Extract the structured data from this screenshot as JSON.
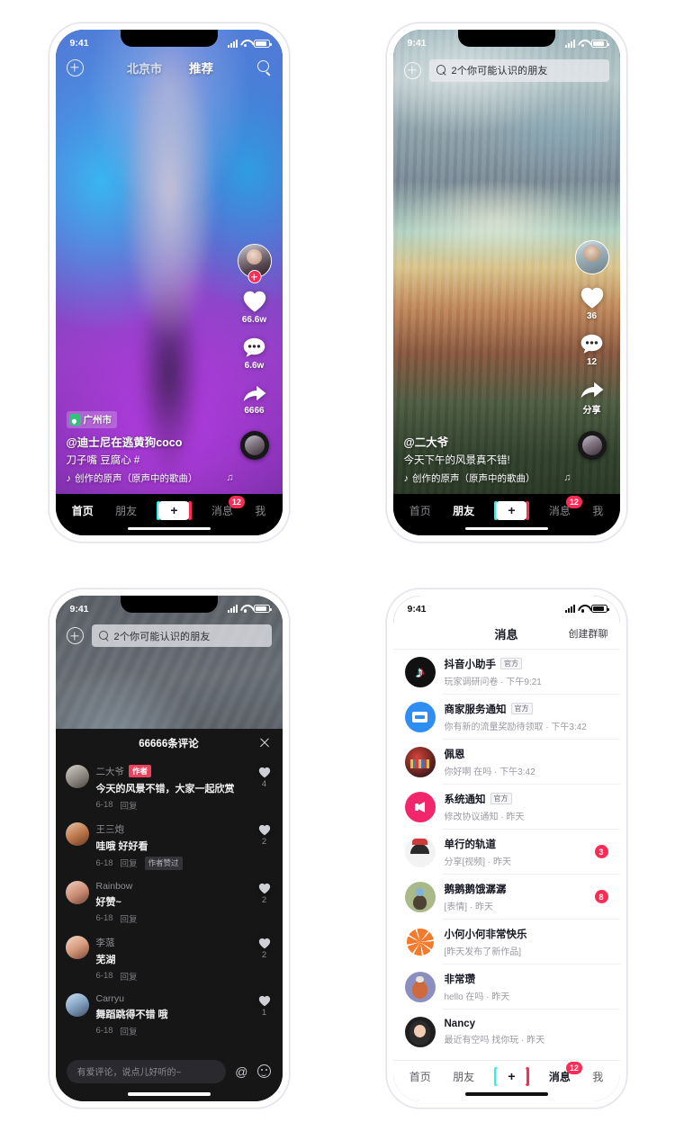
{
  "status_bar": {
    "time": "9:41",
    "signal_icon": "cellular-bars-icon",
    "wifi_icon": "wifi-icon",
    "battery_icon": "battery-icon"
  },
  "screen1": {
    "name": "home-feed",
    "nav": {
      "add_friend_icon": "plus-circle-icon",
      "tabs": [
        {
          "label": "北京市",
          "active": false
        },
        {
          "label": "推荐",
          "active": true
        }
      ],
      "search_icon": "search-icon"
    },
    "rail": {
      "avatar_name": "creator-avatar",
      "follow_icon": "follow-plus-icon",
      "like_icon": "heart-icon",
      "like_count": "66.6w",
      "comment_icon": "comment-icon",
      "comment_count": "6.6w",
      "share_icon": "share-arrow-icon",
      "share_count": "6666",
      "music_disc": "music-disc-icon"
    },
    "caption": {
      "location_icon": "location-pin-icon",
      "location": "广州市",
      "username": "@迪士尼在逃黄狗coco",
      "text": "刀子嘴 豆腐心 #",
      "music_icon": "music-note-icon",
      "music": "创作的原声（原声中的歌曲）"
    }
  },
  "screen2": {
    "name": "friends-feed",
    "header": {
      "add_friend_icon": "plus-circle-icon",
      "search_icon": "search-icon",
      "search_placeholder": "2个你可能认识的朋友"
    },
    "rail": {
      "avatar_name": "creator-avatar",
      "like_icon": "heart-icon",
      "like_count": "36",
      "comment_icon": "comment-icon",
      "comment_count": "12",
      "share_icon": "share-arrow-icon",
      "share_label": "分享",
      "music_disc": "music-disc-icon"
    },
    "caption": {
      "username": "@二大爷",
      "text": "今天下午的风景真不错!",
      "music_icon": "music-note-icon",
      "music": "创作的原声（原声中的歌曲）"
    }
  },
  "screen3": {
    "name": "comments-sheet",
    "header": {
      "add_friend_icon": "plus-circle-icon",
      "search_icon": "search-icon",
      "search_placeholder": "2个你可能认识的朋友"
    },
    "sheet": {
      "title": "66666条评论",
      "close_icon": "close-icon",
      "comments": [
        {
          "name": "二大爷",
          "tag": "作者",
          "text": "今天的风景不错，大家一起欣赏",
          "date": "6-18",
          "reply": "回复",
          "liked_by_author": "",
          "likes": "4",
          "avatar": "cav-1"
        },
        {
          "name": "王三炮",
          "tag": "",
          "text": "哇哦 好好看",
          "date": "6-18",
          "reply": "回复",
          "liked_by_author": "作者赞过",
          "likes": "2",
          "avatar": "cav-2"
        },
        {
          "name": "Rainbow",
          "tag": "",
          "text": "好赞~",
          "date": "6-18",
          "reply": "回复",
          "liked_by_author": "",
          "likes": "2",
          "avatar": "cav-3"
        },
        {
          "name": "李蒎",
          "tag": "",
          "text": "芜湖",
          "date": "6-18",
          "reply": "回复",
          "liked_by_author": "",
          "likes": "2",
          "avatar": "cav-4"
        },
        {
          "name": "Carryu",
          "tag": "",
          "text": "舞蹈跳得不错 哦",
          "date": "6-18",
          "reply": "回复",
          "liked_by_author": "",
          "likes": "1",
          "avatar": "cav-5"
        }
      ],
      "input_placeholder": "有爱评论，说点儿好听的~",
      "at_icon": "at-icon",
      "emoji_icon": "emoji-icon"
    }
  },
  "screen4": {
    "name": "messages",
    "header": {
      "title": "消息",
      "action": "创建群聊"
    },
    "rows": [
      {
        "name": "抖音小助手",
        "tag": "官方",
        "sub": "玩家调研问卷 · 下午9:21",
        "badge": "",
        "avatar": "a-dy"
      },
      {
        "name": "商家服务通知",
        "tag": "官方",
        "sub": "你有新的流量奖励待领取 · 下午3:42",
        "badge": "",
        "avatar": "a-shop"
      },
      {
        "name": "佩恩",
        "tag": "",
        "sub": "你好啊 在吗 · 下午3:42",
        "badge": "",
        "avatar": "a-peien"
      },
      {
        "name": "系统通知",
        "tag": "官方",
        "sub": "修改协议通知 · 昨天",
        "badge": "",
        "avatar": "a-sys"
      },
      {
        "name": "单行的轨道",
        "tag": "",
        "sub": "分享[视频] · 昨天",
        "badge": "3",
        "avatar": "a-cat"
      },
      {
        "name": "鹅鹅鹅饿潺潺",
        "tag": "",
        "sub": "[表情] · 昨天",
        "badge": "8",
        "avatar": "a-duck"
      },
      {
        "name": "小何小何非常快乐",
        "tag": "",
        "sub": "[昨天发布了新作品]",
        "badge": "",
        "avatar": "a-orange"
      },
      {
        "name": "非常瓒",
        "tag": "",
        "sub": "hello 在吗 · 昨天",
        "badge": "",
        "avatar": "a-bird"
      },
      {
        "name": "Nancy",
        "tag": "",
        "sub": "最近有空吗 找你玩 · 昨天",
        "badge": "",
        "avatar": "a-nancy"
      }
    ]
  },
  "tabbar": {
    "home": "首页",
    "friends": "朋友",
    "create": "+",
    "messages": "消息",
    "me": "我",
    "badge": "12"
  },
  "colors": {
    "accent_red": "#fe2c55",
    "accent_cyan": "#25f4ee",
    "author_tag": "#f0405e",
    "location_green": "#31c27c",
    "dark_sheet": "#161616"
  }
}
